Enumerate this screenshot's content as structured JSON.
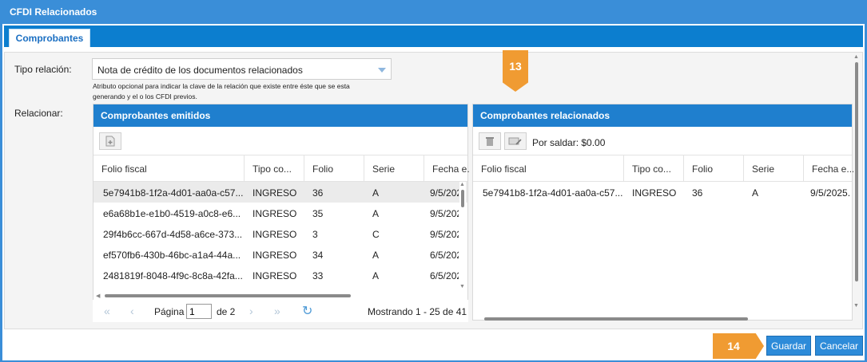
{
  "window": {
    "title": "CFDI Relacionados"
  },
  "tabs": [
    {
      "label": "Comprobantes"
    }
  ],
  "form": {
    "tipo_relacion_label": "Tipo relación:",
    "tipo_relacion_value": "Nota de crédito de los documentos relacionados",
    "hint_line1": "Atributo opcional para indicar la clave de la relación que existe entre éste que se esta",
    "hint_line2": "generando y el o los CFDI previos.",
    "relacionar_label": "Relacionar:"
  },
  "callouts": {
    "step13": "13",
    "step14": "14"
  },
  "left_panel": {
    "title": "Comprobantes emitidos",
    "add_icon": "add-document-icon",
    "columns": [
      "Folio fiscal",
      "Tipo co...",
      "Folio",
      "Serie",
      "Fecha e..."
    ],
    "rows": [
      [
        "5e7941b8-1f2a-4d01-aa0a-c57...",
        "INGRESO",
        "36",
        "A",
        "9/5/202"
      ],
      [
        "e6a68b1e-e1b0-4519-a0c8-e6...",
        "INGRESO",
        "35",
        "A",
        "9/5/202"
      ],
      [
        "29f4b6cc-667d-4d58-a6ce-373...",
        "INGRESO",
        "3",
        "C",
        "9/5/202"
      ],
      [
        "ef570fb6-430b-46bc-a1a4-44a...",
        "INGRESO",
        "34",
        "A",
        "6/5/202"
      ],
      [
        "2481819f-8048-4f9c-8c8a-42fa...",
        "INGRESO",
        "33",
        "A",
        "6/5/202"
      ]
    ]
  },
  "right_panel": {
    "title": "Comprobantes relacionados",
    "saldo_label": "Por saldar: $0.00",
    "columns": [
      "Folio fiscal",
      "Tipo co...",
      "Folio",
      "Serie",
      "Fecha e..."
    ],
    "rows": [
      [
        "5e7941b8-1f2a-4d01-aa0a-c57...",
        "INGRESO",
        "36",
        "A",
        "9/5/2025."
      ]
    ]
  },
  "pager": {
    "page_label": "Página",
    "page_value": "1",
    "of_label": "de 2",
    "showing": "Mostrando 1 - 25 de 41"
  },
  "footer": {
    "save_label": "Guardar",
    "cancel_label": "Cancelar"
  },
  "colors": {
    "accent": "#1f7fce",
    "callout": "#f09b32"
  }
}
